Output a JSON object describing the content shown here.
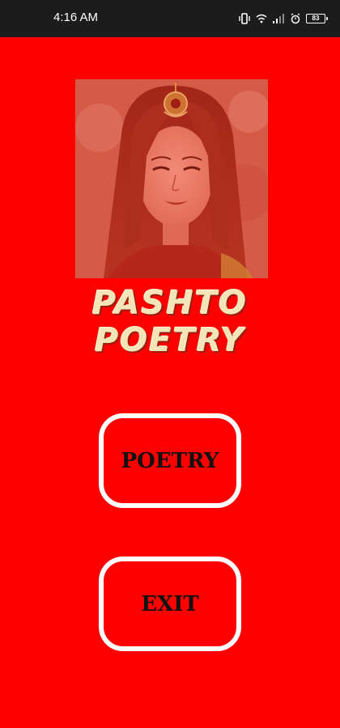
{
  "status_bar": {
    "time": "4:16 AM",
    "battery_level": "83",
    "icons": [
      "vibrate-icon",
      "wifi-icon",
      "signal-icon",
      "alarm-icon",
      "battery-icon"
    ]
  },
  "app": {
    "title_line1": "PASHTO",
    "title_line2": "POETRY"
  },
  "buttons": {
    "poetry_label": "POETRY",
    "exit_label": "EXIT"
  },
  "colors": {
    "background": "#ff0000",
    "status_bar": "#1c1c1c",
    "title": "#f3e5b8",
    "button_border": "#ffffff",
    "button_text": "#111111"
  }
}
